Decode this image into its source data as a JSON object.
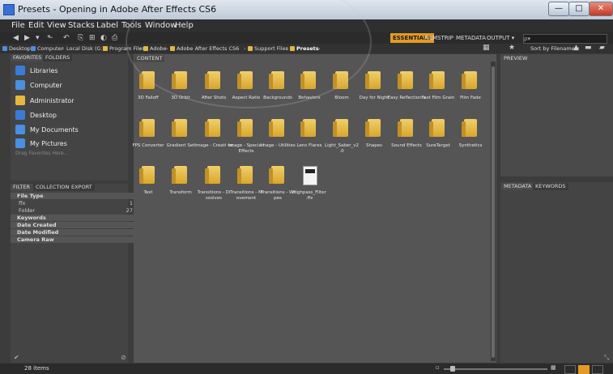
{
  "window": {
    "title": "Presets - Opening in Adobe After Effects CS6"
  },
  "menu": [
    "File",
    "Edit",
    "View",
    "Stacks",
    "Label",
    "Tools",
    "Window",
    "Help"
  ],
  "workspaces": {
    "active": "ESSENTIALS",
    "items": [
      "FILMSTRIP",
      "METADATA",
      "OUTPUT ▾"
    ]
  },
  "search": {
    "placeholder": "ρ▾"
  },
  "sort": {
    "label": "Sort by Filename ▾"
  },
  "breadcrumb": [
    "Desktop",
    "Computer",
    "Local Disk (C:)",
    "Program Files",
    "Adobe",
    "Adobe After Effects CS6",
    "Support Files",
    "Presets"
  ],
  "panels": {
    "favorites_tab": "FAVORITES",
    "folders_tab": "FOLDERS",
    "filter_tab": "FILTER",
    "collections_tab": "COLLECTIONS",
    "export_tab": "EXPORT",
    "content_tab": "CONTENT",
    "preview_tab": "PREVIEW",
    "metadata_tab": "METADATA",
    "keywords_tab": "KEYWORDS"
  },
  "favorites": [
    {
      "label": "Libraries",
      "color": "#3a7bd5"
    },
    {
      "label": "Computer",
      "color": "#4a8fe0"
    },
    {
      "label": "Administrator",
      "color": "#e4b740"
    },
    {
      "label": "Desktop",
      "color": "#3a7bd5"
    },
    {
      "label": "My Documents",
      "color": "#4a8fe0"
    },
    {
      "label": "My Pictures",
      "color": "#4a8fe0"
    }
  ],
  "favorites_hint": "Drag Favorites Here...",
  "filter": {
    "file_type": {
      "label": "File Type",
      "rows": [
        {
          "name": "ffx",
          "count": "1"
        },
        {
          "name": "Folder",
          "count": "27"
        }
      ]
    },
    "sections": [
      "Keywords",
      "Date Created",
      "Date Modified",
      "Camera Raw"
    ]
  },
  "items": [
    {
      "name": "3D Falloff",
      "kind": "folder"
    },
    {
      "name": "3D Orbit",
      "kind": "folder"
    },
    {
      "name": "After Shots",
      "kind": "folder"
    },
    {
      "name": "Aspect Ratio",
      "kind": "folder"
    },
    {
      "name": "Backgrounds",
      "kind": "folder"
    },
    {
      "name": "Behaviors",
      "kind": "folder"
    },
    {
      "name": "Bloom",
      "kind": "folder"
    },
    {
      "name": "Day for Night",
      "kind": "folder"
    },
    {
      "name": "Easy Reflection s",
      "kind": "folder"
    },
    {
      "name": "Fast Film Grain",
      "kind": "folder"
    },
    {
      "name": "Film Fade",
      "kind": "folder"
    },
    {
      "name": "FPS Converter",
      "kind": "folder"
    },
    {
      "name": "Gradient Set",
      "kind": "folder"
    },
    {
      "name": "Image - Creati ve",
      "kind": "folder"
    },
    {
      "name": "Image - Specia l Effects",
      "kind": "folder"
    },
    {
      "name": "Image - Utilities",
      "kind": "folder"
    },
    {
      "name": "Lens Flares",
      "kind": "folder"
    },
    {
      "name": "Light_Saber_v2 .0",
      "kind": "folder"
    },
    {
      "name": "Shapes",
      "kind": "folder"
    },
    {
      "name": "Sound Effects",
      "kind": "folder"
    },
    {
      "name": "SureTarget",
      "kind": "folder"
    },
    {
      "name": "Synthetics",
      "kind": "folder"
    },
    {
      "name": "Text",
      "kind": "folder"
    },
    {
      "name": "Transform",
      "kind": "folder"
    },
    {
      "name": "Transitions - Di ssolves",
      "kind": "folder"
    },
    {
      "name": "Transitions - M ovement",
      "kind": "folder"
    },
    {
      "name": "Transitions - Wi pes",
      "kind": "folder"
    },
    {
      "name": "Highpass_Filter .ffx",
      "kind": "file"
    }
  ],
  "status": {
    "count": "28 items"
  }
}
